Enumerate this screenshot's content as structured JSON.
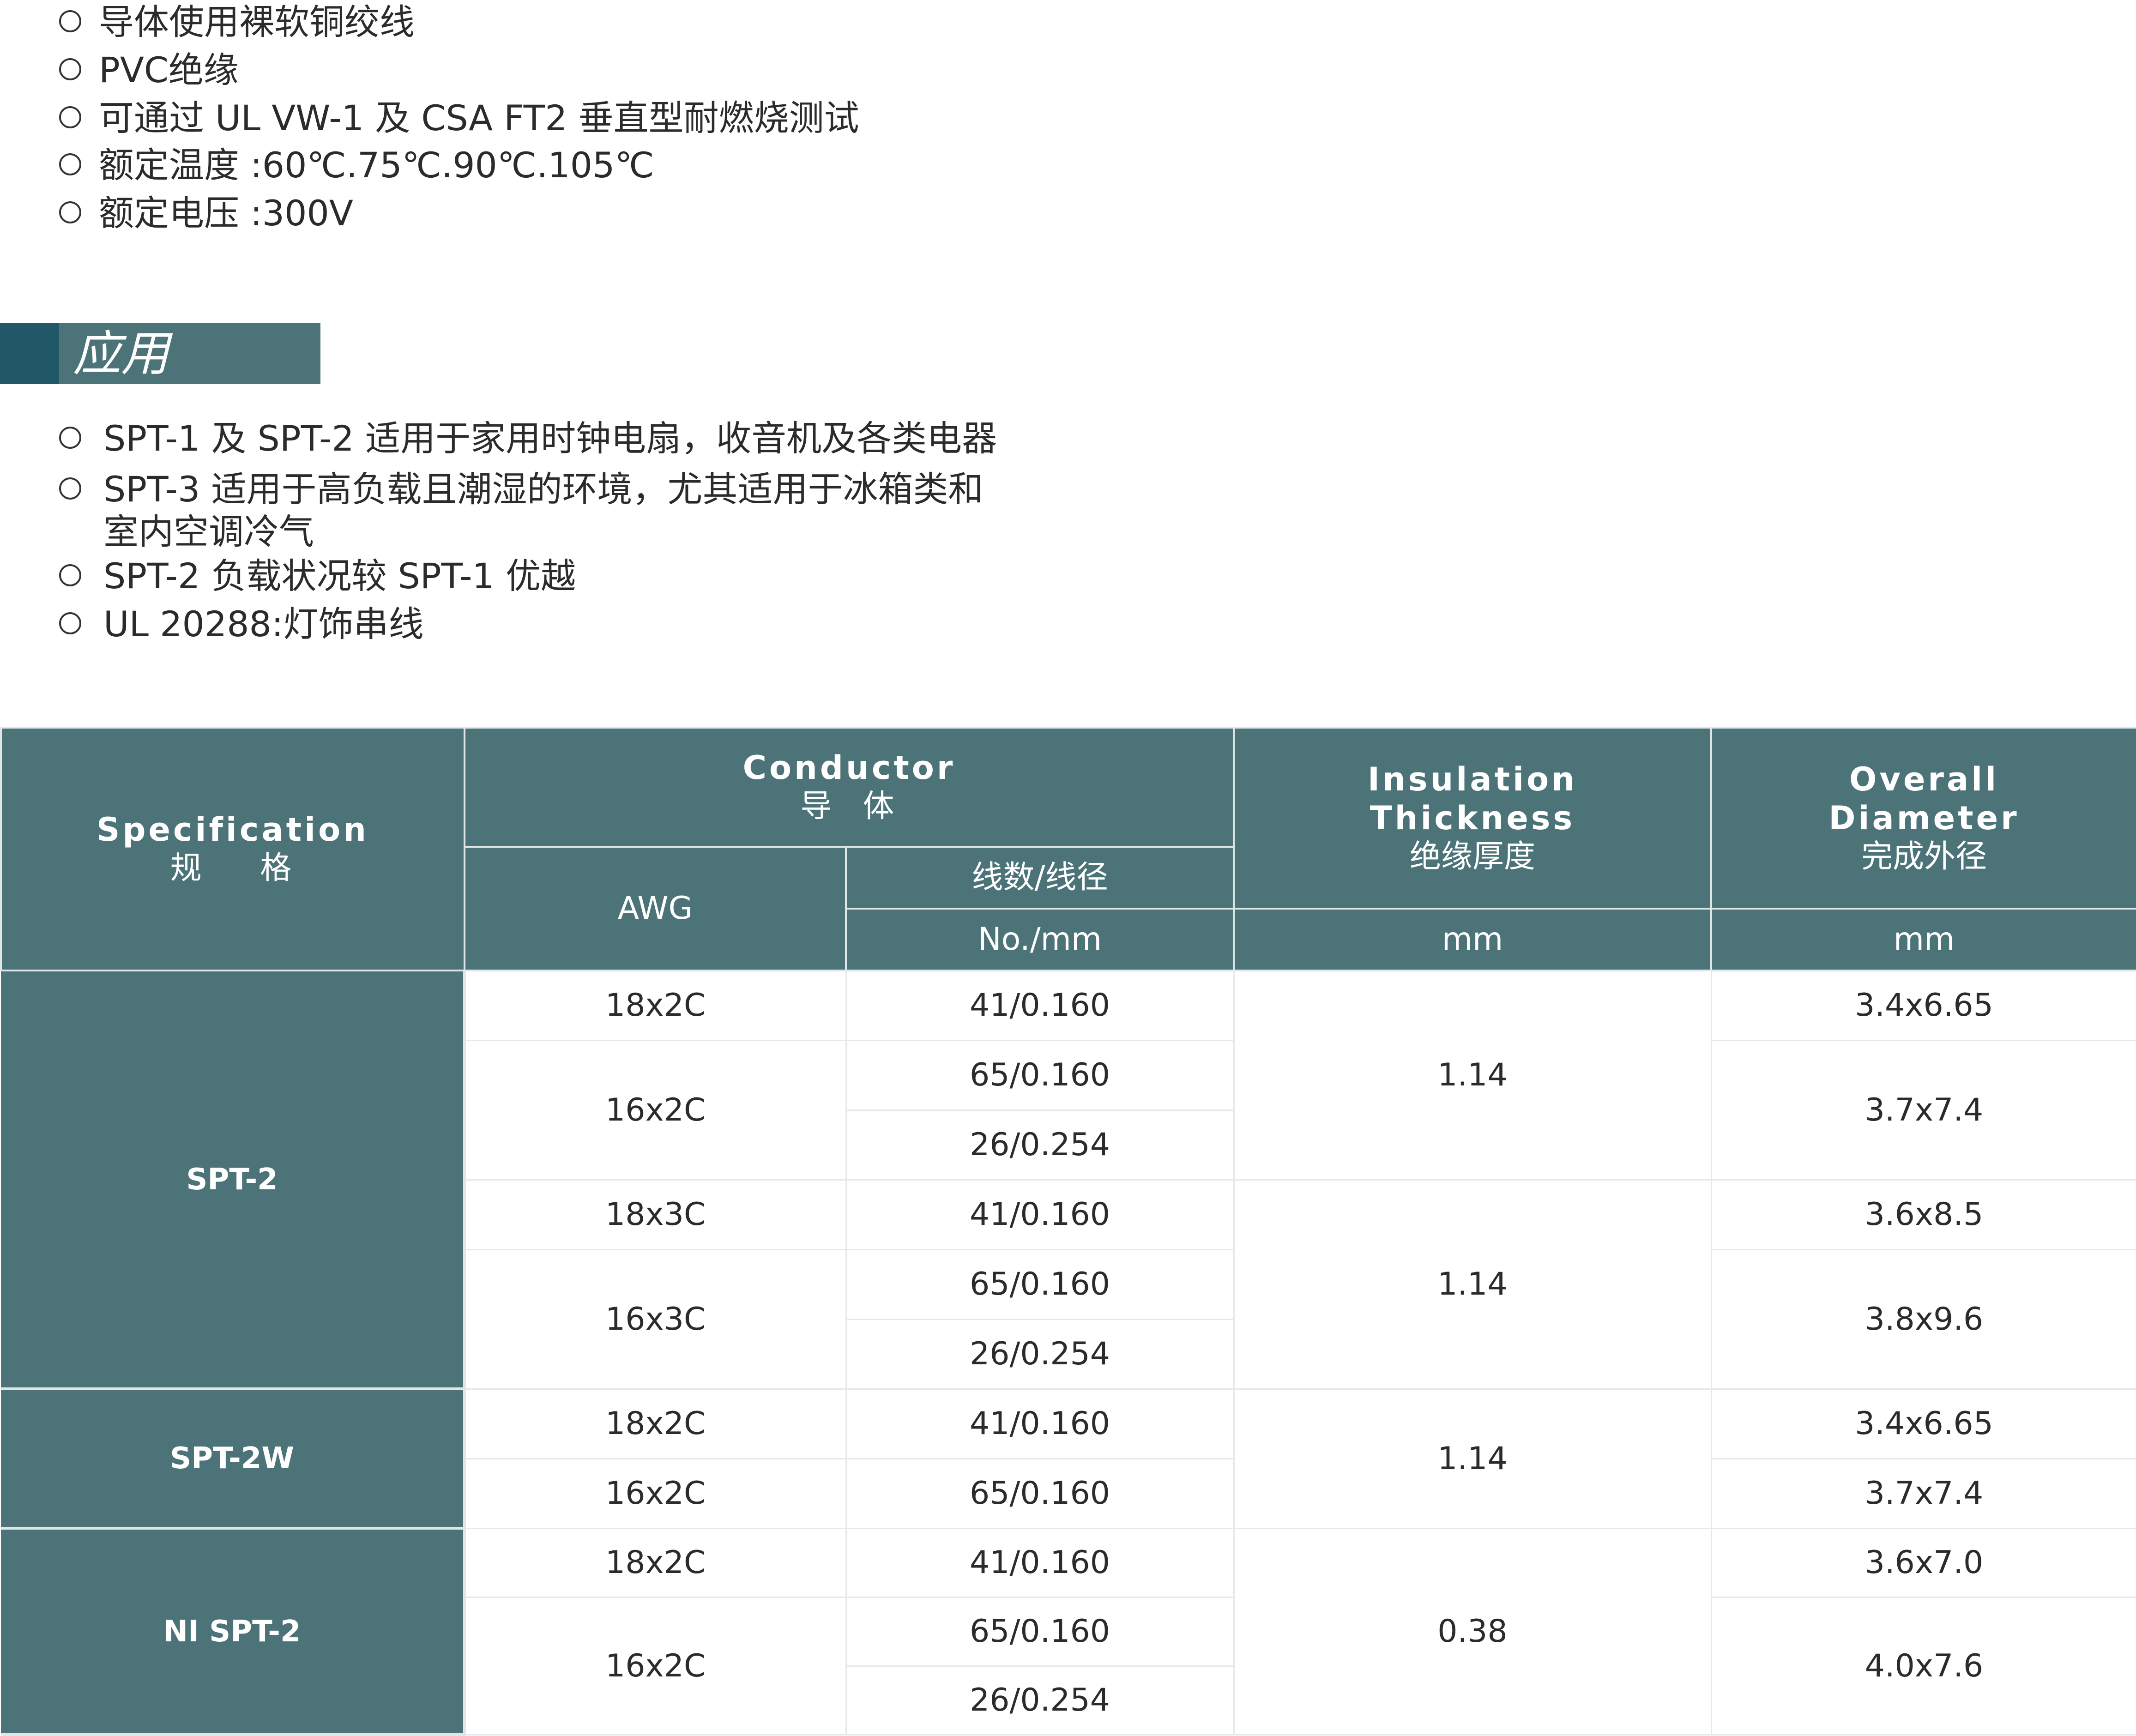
{
  "features": [
    "导体使用裸软铜绞线",
    "PVC绝缘",
    "可通过 UL VW-1 及 CSA FT2 垂直型耐燃烧测试",
    "额定温度 :60℃.75℃.90℃.105℃",
    "额定电压 :300V"
  ],
  "application": {
    "title": "应用",
    "items": [
      "SPT-1 及 SPT-2 适用于家用时钟电扇，收音机及各类电器",
      "SPT-3 适用于高负载且潮湿的环境，尤其适用于冰箱类和",
      "SPT-2 负载状况较 SPT-1 优越",
      "UL 20288:灯饰串线"
    ],
    "item2_cont": "室内空调冷气"
  },
  "table": {
    "headers": {
      "spec_en": "Specification",
      "spec_cn": "规    格",
      "conductor_en": "Conductor",
      "conductor_cn": "导  体",
      "awg": "AWG",
      "strand_cn": "线数/线径",
      "strand_unit": "No./mm",
      "ins_en1": "Insulation",
      "ins_en2": "Thickness",
      "ins_cn": "绝缘厚度",
      "ins_unit": "mm",
      "od_en1": "Overall",
      "od_en2": "Diameter",
      "od_cn": "完成外径",
      "od_unit": "mm"
    },
    "rows": [
      {
        "spec": "SPT-2",
        "awg": "18x2C",
        "strand": "41/0.160",
        "ins": "1.14",
        "od": "3.4x6.65"
      },
      {
        "awg": "16x2C",
        "strand": "65/0.160",
        "od": "3.7x7.4"
      },
      {
        "strand": "26/0.254"
      },
      {
        "awg": "18x3C",
        "strand": "41/0.160",
        "ins": "1.14",
        "od": "3.6x8.5"
      },
      {
        "awg": "16x3C",
        "strand": "65/0.160",
        "od": "3.8x9.6"
      },
      {
        "strand": "26/0.254"
      },
      {
        "spec": "SPT-2W",
        "awg": "18x2C",
        "strand": "41/0.160",
        "ins": "1.14",
        "od": "3.4x6.65"
      },
      {
        "awg": "16x2C",
        "strand": "65/0.160",
        "od": "3.7x7.4"
      },
      {
        "spec": "NI SPT-2",
        "awg": "18x2C",
        "strand": "41/0.160",
        "ins": "0.38",
        "od": "3.6x7.0"
      },
      {
        "awg": "16x2C",
        "strand": "65/0.160",
        "od": "4.0x7.6"
      },
      {
        "strand": "26/0.254"
      }
    ]
  }
}
